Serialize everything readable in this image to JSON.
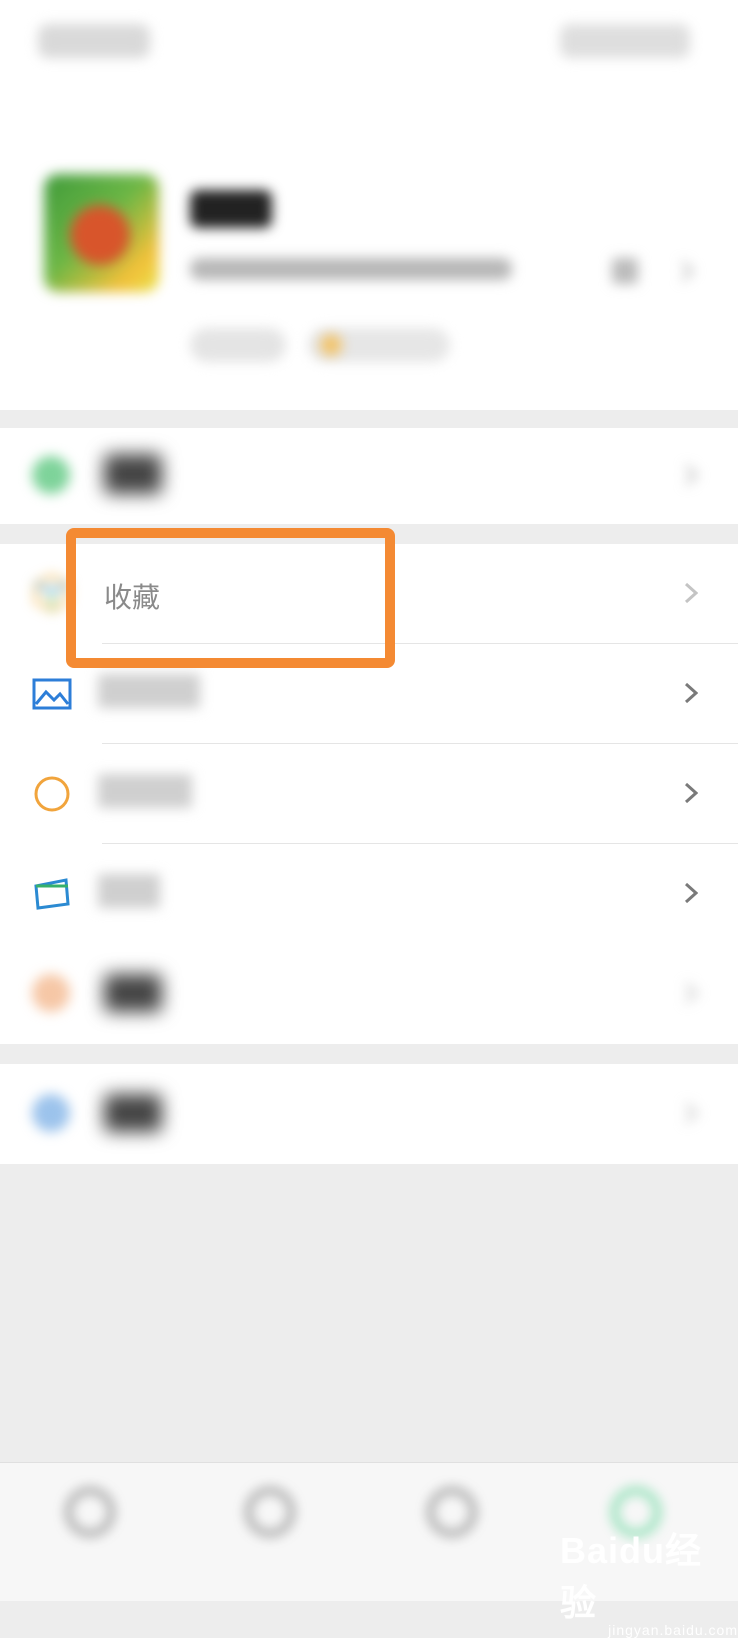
{
  "header": {
    "left_pill": "",
    "right_pill": ""
  },
  "profile": {
    "name": "",
    "wechat_id": "",
    "status": "",
    "friends_status": ""
  },
  "menu": {
    "pay_label": "",
    "favorites_label": "收藏",
    "moments_label": "",
    "channels_label": "",
    "cards_label": "",
    "stickers_label": "",
    "settings_label": ""
  },
  "tabbar": {
    "tab1": "",
    "tab2": "",
    "tab3": "",
    "tab4": ""
  },
  "watermark": {
    "text": "Baidu经验",
    "sub": "jingyan.baidu.com"
  },
  "colors": {
    "highlight": "#f48a33",
    "background": "#ededed",
    "accent_green": "#07c160"
  }
}
